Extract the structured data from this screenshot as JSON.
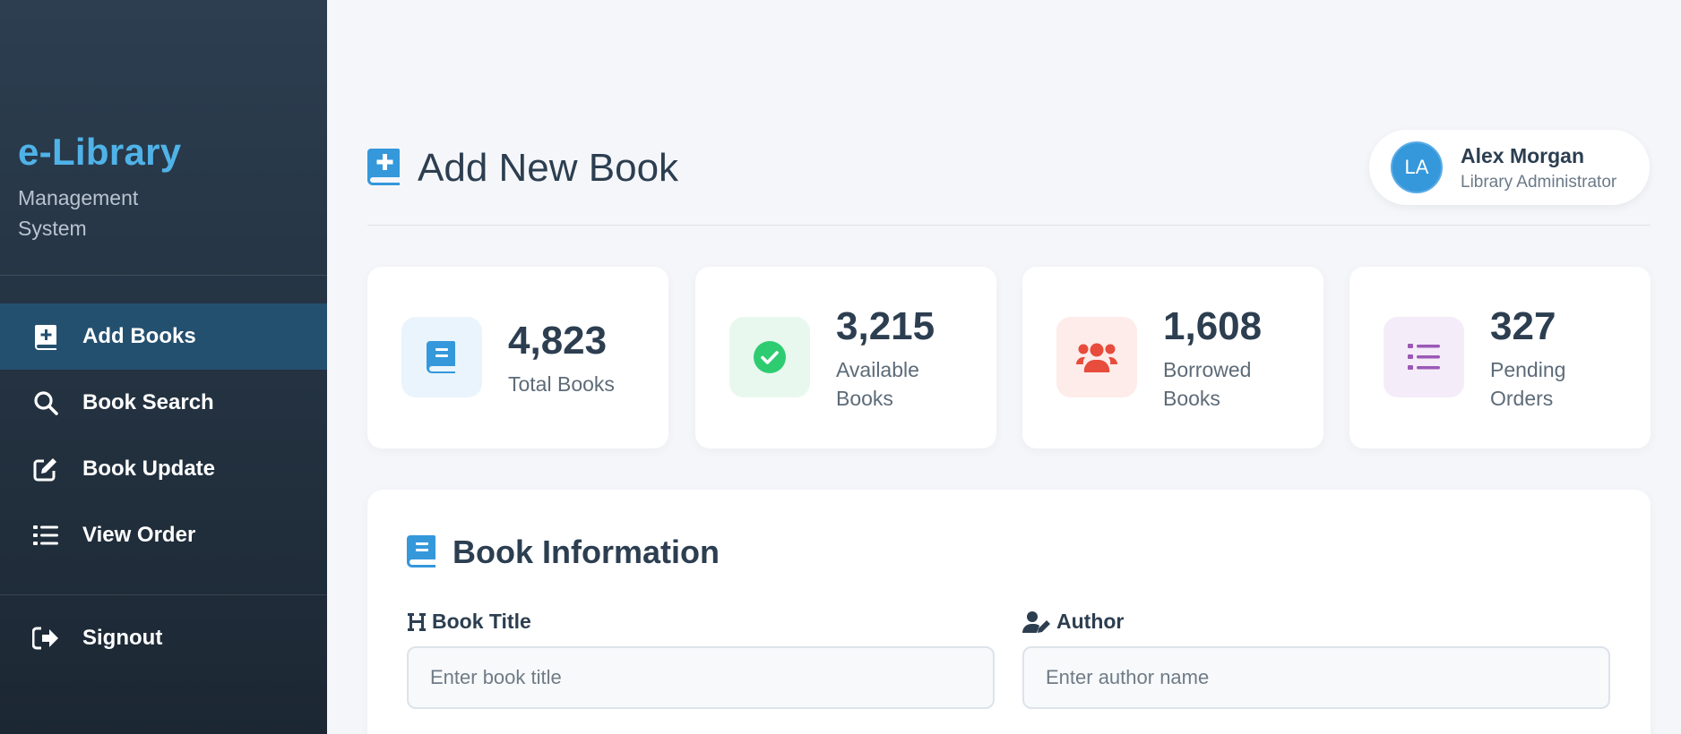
{
  "sidebar": {
    "brand_title": "e-Library",
    "brand_subtitle": "Management System",
    "items": [
      {
        "label": "Add Books",
        "icon": "book-plus-icon",
        "active": true
      },
      {
        "label": "Book Search",
        "icon": "search-icon",
        "active": false
      },
      {
        "label": "Book Update",
        "icon": "edit-icon",
        "active": false
      },
      {
        "label": "View Order",
        "icon": "list-icon",
        "active": false
      }
    ],
    "signout_label": "Signout"
  },
  "header": {
    "title": "Add New Book",
    "user": {
      "initials": "LA",
      "name": "Alex Morgan",
      "role": "Library Administrator"
    }
  },
  "stats": [
    {
      "value": "4,823",
      "label": "Total Books",
      "icon": "book-icon",
      "color": "#3498db",
      "bg": "#eaf4fc"
    },
    {
      "value": "3,215",
      "label": "Available Books",
      "icon": "check-circle-icon",
      "color": "#2ecc71",
      "bg": "#e8f8ee"
    },
    {
      "value": "1,608",
      "label": "Borrowed Books",
      "icon": "users-icon",
      "color": "#e74c3c",
      "bg": "#fdecea"
    },
    {
      "value": "327",
      "label": "Pending Orders",
      "icon": "list-icon",
      "color": "#9b59b6",
      "bg": "#f4ecf8"
    }
  ],
  "form": {
    "section_title": "Book Information",
    "fields": [
      {
        "label": "Book Title",
        "placeholder": "Enter book title",
        "value": ""
      },
      {
        "label": "Author",
        "placeholder": "Enter author name",
        "value": ""
      }
    ]
  },
  "colors": {
    "accent": "#3498db",
    "sidebar_bg": "#2c3e50",
    "active_nav": "#24506f",
    "brand": "#4fb3e8"
  }
}
